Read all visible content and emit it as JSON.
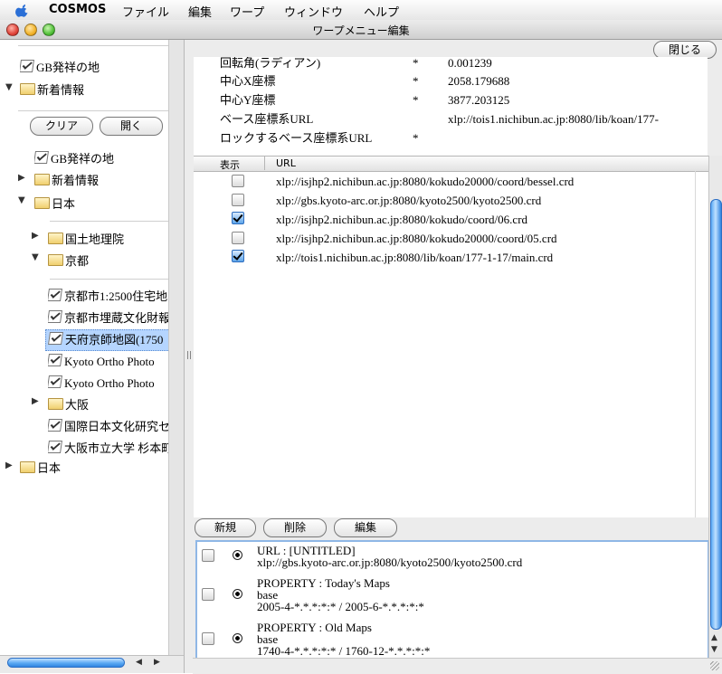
{
  "menubar": {
    "app_name": "COSMOS",
    "items": [
      "ファイル",
      "編集",
      "ワープ",
      "ウィンドウ",
      "ヘルプ"
    ]
  },
  "window": {
    "title": "ワープメニュー編集"
  },
  "left_tree_top": [
    {
      "label": "GB発祥の地",
      "icon": "checked-doc-icon"
    },
    {
      "label": "新着情報",
      "icon": "folder-icon",
      "state": "expanded"
    }
  ],
  "left_buttons": {
    "clear": "クリア",
    "open": "開く"
  },
  "left_tree": [
    {
      "label": "GB発祥の地"
    },
    {
      "label": "新着情報"
    },
    {
      "label": "日本"
    },
    {
      "label": "国土地理院"
    },
    {
      "label": "京都"
    },
    {
      "label": "京都市1:2500住宅地"
    },
    {
      "label": "京都市埋蔵文化財報"
    },
    {
      "label": "天府京師地図(1750"
    },
    {
      "label": "Kyoto Ortho Photo"
    },
    {
      "label": "Kyoto Ortho Photo"
    },
    {
      "label": "大阪"
    },
    {
      "label": "国際日本文化研究セ"
    },
    {
      "label": "大阪市立大学 杉本町"
    },
    {
      "label": "日本"
    }
  ],
  "close_button": "閉じる",
  "properties": [
    {
      "name": "回転角(ラディアン)",
      "req": "*",
      "value": "0.001239"
    },
    {
      "name": "中心X座標",
      "req": "*",
      "value": "2058.179688"
    },
    {
      "name": "中心Y座標",
      "req": "*",
      "value": "3877.203125"
    },
    {
      "name": "ベース座標系URL",
      "req": "",
      "value": "xlp://tois1.nichibun.ac.jp:8080/lib/koan/177-"
    },
    {
      "name": "ロックするベース座標系URL",
      "req": "*",
      "value": ""
    }
  ],
  "url_table": {
    "col_display": "表示",
    "col_url": "URL",
    "rows": [
      {
        "checked": false,
        "url": "xlp://isjhp2.nichibun.ac.jp:8080/kokudo20000/coord/bessel.crd"
      },
      {
        "checked": false,
        "url": "xlp://gbs.kyoto-arc.or.jp:8080/kyoto2500/kyoto2500.crd"
      },
      {
        "checked": true,
        "url": "xlp://isjhp2.nichibun.ac.jp:8080/kokudo/coord/06.crd"
      },
      {
        "checked": false,
        "url": "xlp://isjhp2.nichibun.ac.jp:8080/kokudo20000/coord/05.crd"
      },
      {
        "checked": true,
        "url": "xlp://tois1.nichibun.ac.jp:8080/lib/koan/177-1-17/main.crd"
      }
    ]
  },
  "action_buttons": {
    "new": "新規",
    "delete": "削除",
    "edit": "編集"
  },
  "items": [
    {
      "line1": "URL : [UNTITLED]",
      "line2": "xlp://gbs.kyoto-arc.or.jp:8080/kyoto2500/kyoto2500.crd",
      "line3": ""
    },
    {
      "line1": "PROPERTY : Today's Maps",
      "line2": "base",
      "line3": "2005-4-*.*.*:*:* / 2005-6-*.*.*:*:*"
    },
    {
      "line1": "PROPERTY : Old Maps",
      "line2": "base",
      "line3": "1740-4-*.*.*:*:* / 1760-12-*.*.*:*:*"
    }
  ],
  "colors": {
    "selection": "#b5d5ff",
    "aqua_blue": "#2f84e0",
    "list_border": "#8fb7e6"
  }
}
